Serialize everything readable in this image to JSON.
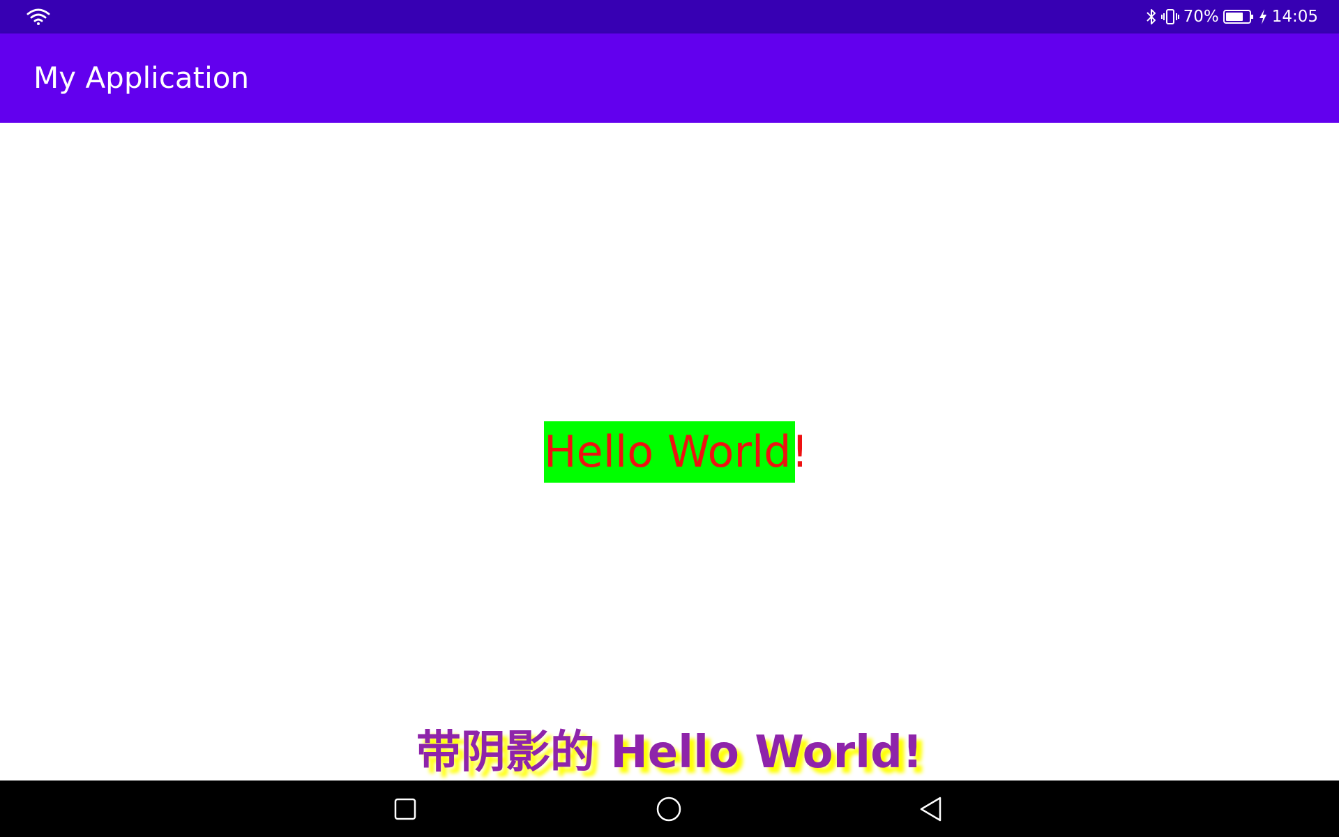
{
  "status_bar": {
    "battery_percent": "70%",
    "time": "14:05",
    "icons": [
      "wifi-icon",
      "bluetooth-icon",
      "vibrate-icon",
      "battery-icon",
      "charging-icon"
    ],
    "color": "#3700B3"
  },
  "app_bar": {
    "title": "My Application",
    "color": "#6200EE"
  },
  "main": {
    "hello_text": "Hello World!",
    "hello_text_color": "#EE1111",
    "hello_background": "#00FF00",
    "shadow_text": "带阴影的 Hello World!",
    "shadow_text_color": "#8E24AA",
    "shadow_color": "#FFFF00"
  },
  "nav_bar": {
    "buttons": [
      "recents-icon",
      "home-icon",
      "back-icon"
    ]
  }
}
